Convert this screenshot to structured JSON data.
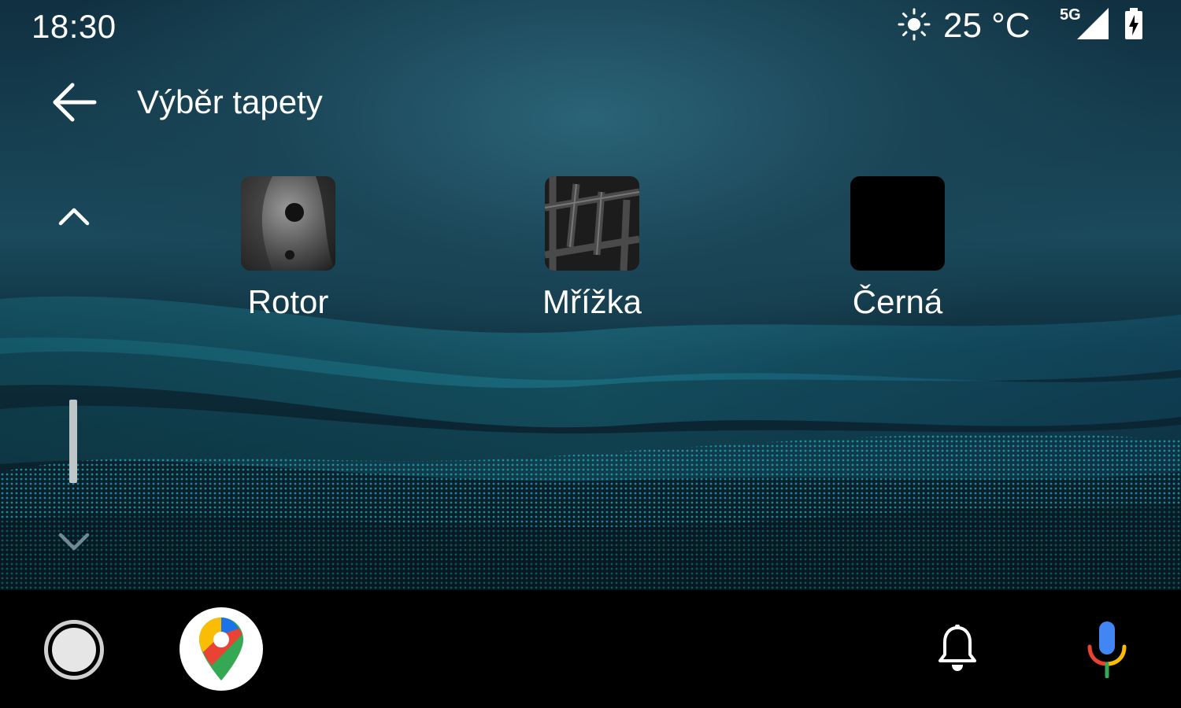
{
  "status_bar": {
    "time": "18:30",
    "weather_icon": "sun-icon",
    "temperature": "25 °C",
    "network": "5G",
    "signal_icon": "cell-signal-icon",
    "battery_icon": "battery-charging-icon"
  },
  "header": {
    "back_icon": "arrow-left-icon",
    "title": "Výběr tapety"
  },
  "scroll": {
    "up_icon": "chevron-up-icon",
    "down_icon": "chevron-down-icon"
  },
  "wallpapers": [
    {
      "label": "Rotor"
    },
    {
      "label": "Mřížka"
    },
    {
      "label": "Černá"
    }
  ],
  "nav_bar": {
    "home_icon": "home-circle-icon",
    "maps_icon": "google-maps-icon",
    "notifications_icon": "bell-icon",
    "assistant_icon": "microphone-icon"
  },
  "colors": {
    "accent_teal": "#1fa0b8",
    "background_dark": "#0d2c3a",
    "nav_background": "#000000"
  }
}
